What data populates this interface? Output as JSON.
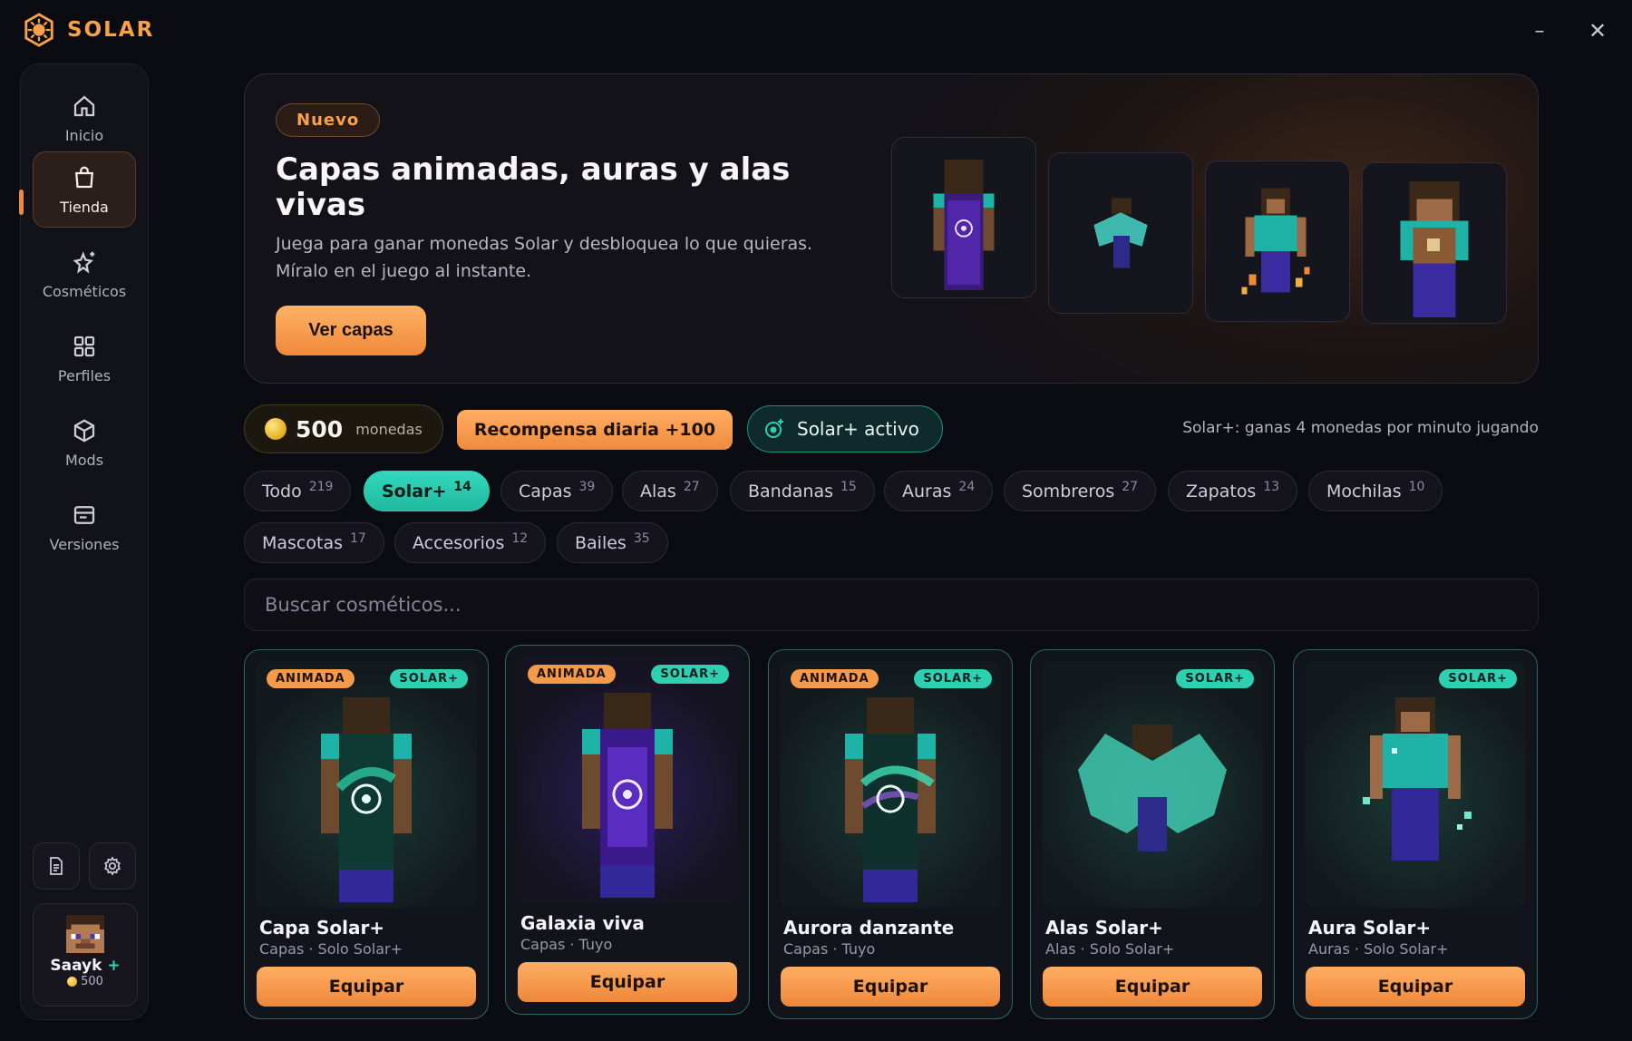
{
  "app": {
    "name": "SOLAR"
  },
  "window": {
    "minimize": "–",
    "close": "✕"
  },
  "sidebar": {
    "items": [
      {
        "label": "Inicio",
        "icon": "home-icon"
      },
      {
        "label": "Tienda",
        "icon": "shopping-bag-icon",
        "active": true
      },
      {
        "label": "Cosméticos",
        "icon": "sparkle-star-icon"
      },
      {
        "label": "Perfiles",
        "icon": "grid-icon"
      },
      {
        "label": "Mods",
        "icon": "cube-icon"
      },
      {
        "label": "Versiones",
        "icon": "window-icon"
      }
    ],
    "profile": {
      "name": "Saayk",
      "plus": "+",
      "coins": "500"
    }
  },
  "hero": {
    "badge": "Nuevo",
    "title": "Capas animadas, auras y alas vivas",
    "subtitle": "Juega para ganar monedas Solar y desbloquea lo que quieras. Míralo en el juego al instante.",
    "button": "Ver capas"
  },
  "wallet": {
    "coins": "500",
    "coins_label": "monedas",
    "daily_reward": "Recompensa diaria +100",
    "solar_status": "Solar+ activo",
    "info": "Solar+: ganas 4 monedas por minuto jugando"
  },
  "filters": [
    {
      "label": "Todo",
      "count": "219"
    },
    {
      "label": "Solar+",
      "count": "14",
      "active": true
    },
    {
      "label": "Capas",
      "count": "39"
    },
    {
      "label": "Alas",
      "count": "27"
    },
    {
      "label": "Bandanas",
      "count": "15"
    },
    {
      "label": "Auras",
      "count": "24"
    },
    {
      "label": "Sombreros",
      "count": "27"
    },
    {
      "label": "Zapatos",
      "count": "13"
    },
    {
      "label": "Mochilas",
      "count": "10"
    },
    {
      "label": "Mascotas",
      "count": "17"
    },
    {
      "label": "Accesorios",
      "count": "12"
    },
    {
      "label": "Bailes",
      "count": "35"
    }
  ],
  "search": {
    "placeholder": "Buscar cosméticos..."
  },
  "cards": [
    {
      "name": "Capa Solar+",
      "meta": "Capas · Solo Solar+",
      "badge_anim": "ANIMADA",
      "badge_solar": "SOLAR+",
      "button": "Equipar"
    },
    {
      "name": "Galaxia viva",
      "meta": "Capas · Tuyo",
      "badge_anim": "ANIMADA",
      "badge_solar": "SOLAR+",
      "button": "Equipar"
    },
    {
      "name": "Aurora danzante",
      "meta": "Capas · Tuyo",
      "badge_anim": "ANIMADA",
      "badge_solar": "SOLAR+",
      "button": "Equipar"
    },
    {
      "name": "Alas Solar+",
      "meta": "Alas · Solo Solar+",
      "badge_solar": "SOLAR+",
      "button": "Equipar"
    },
    {
      "name": "Aura Solar+",
      "meta": "Auras · Solo Solar+",
      "badge_solar": "SOLAR+",
      "button": "Equipar"
    }
  ]
}
